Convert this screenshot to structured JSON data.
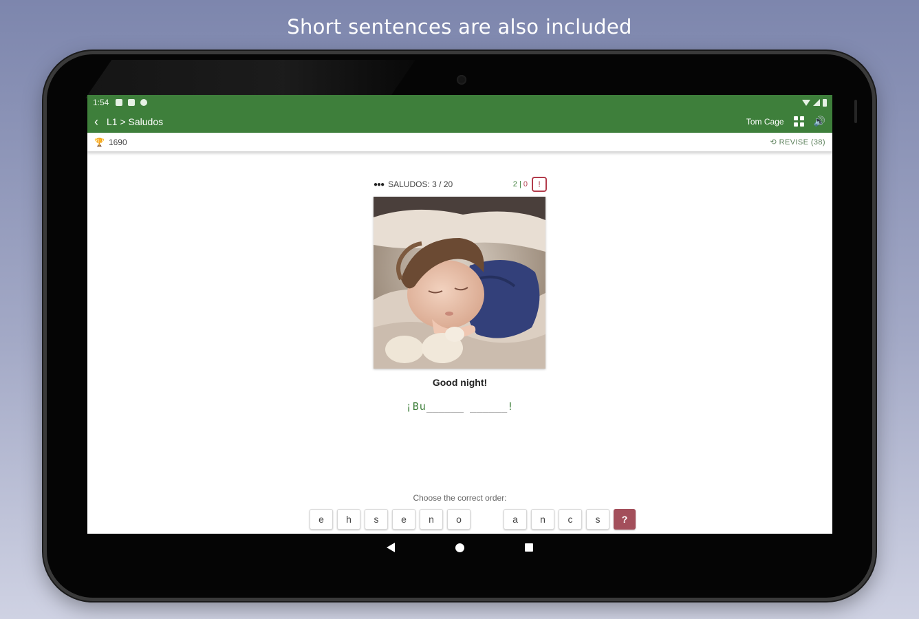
{
  "headline": "Short sentences are also included",
  "status_bar": {
    "time": "1:54"
  },
  "app_bar": {
    "back_glyph": "‹",
    "breadcrumb": "L1 > Saludos",
    "user_name": "Tom Cage"
  },
  "sub_bar": {
    "points": "1690",
    "revise_label": "⟲ REVISE (38)"
  },
  "lesson": {
    "progress": "SALUDOS: 3 / 20",
    "score_correct": "2",
    "score_separator": " | ",
    "score_wrong": "0",
    "alert_glyph": "!"
  },
  "exercise": {
    "phrase": "Good night!",
    "answer_open": "¡",
    "answer_typed": "Bu",
    "answer_blanks": "______ ______",
    "answer_close": "!",
    "instruction": "Choose the correct order:",
    "group1": [
      "e",
      "h",
      "s",
      "e",
      "n",
      "o"
    ],
    "group2": [
      "a",
      "n",
      "c",
      "s"
    ],
    "hint_label": "?"
  },
  "colors": {
    "primary": "#3e7f3b",
    "accent_red": "#b23b4b",
    "hint_button": "#a34f5b",
    "background_top": "#7d86ad"
  },
  "icons": {
    "status": [
      "notification-icon",
      "sd-card-icon",
      "sync-icon",
      "wifi-icon",
      "signal-icon",
      "battery-icon"
    ],
    "app_bar": [
      "back-arrow-icon",
      "grid-icon",
      "speaker-icon"
    ],
    "sub_bar": [
      "trophy-icon",
      "revise-icon"
    ],
    "nav": [
      "nav-back-icon",
      "nav-home-icon",
      "nav-recent-icon"
    ]
  }
}
